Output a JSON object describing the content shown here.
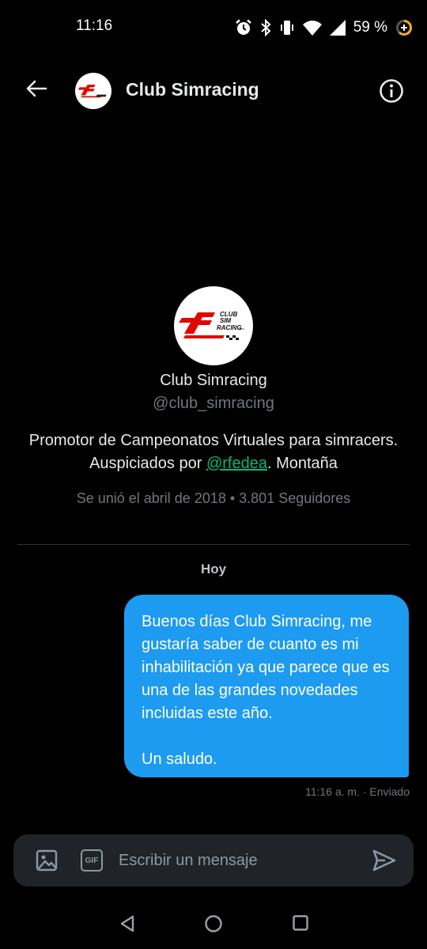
{
  "status_bar": {
    "time": "11:16",
    "battery": "59 %",
    "icons": [
      "alarm-icon",
      "bluetooth-icon",
      "vibrate-icon",
      "wifi-icon",
      "signal-icon",
      "battery-icon"
    ]
  },
  "header": {
    "title": "Club Simracing",
    "back_icon": "arrow-left-icon",
    "info_icon": "info-icon"
  },
  "profile": {
    "logo_text": [
      "CLUB",
      "SIM",
      "RACING"
    ],
    "logo_suffix": ".com",
    "name": "Club Simracing",
    "handle": "@club_simracing",
    "bio_before": "Promotor de Campeonatos Virtuales para simracers. Auspiciados por ",
    "bio_link": "@rfedea",
    "bio_after": ". Montaña",
    "meta": "Se unió el abril de 2018 • 3.801 Seguidores"
  },
  "conversation": {
    "day_label": "Hoy",
    "messages": [
      {
        "text": "Buenos días Club Simracing, me gustaría saber de cuanto es mi inhabilitación ya que parece que es una de las grandes novedades incluidas este año.\n\nUn saludo.",
        "meta": "11:16 a. m. · Enviado"
      }
    ]
  },
  "composer": {
    "placeholder": "Escribir un mensaje",
    "gif_label": "GIF",
    "icons": [
      "image-icon",
      "gif-icon",
      "send-icon"
    ]
  },
  "nav_bar": {
    "icons": [
      "nav-back-icon",
      "nav-home-icon",
      "nav-recents-icon"
    ]
  },
  "colors": {
    "background": "#000000",
    "bubble": "#1d9bf0",
    "composer": "#202327",
    "secondary_text": "#71767b",
    "brand_red": "#e10600"
  }
}
